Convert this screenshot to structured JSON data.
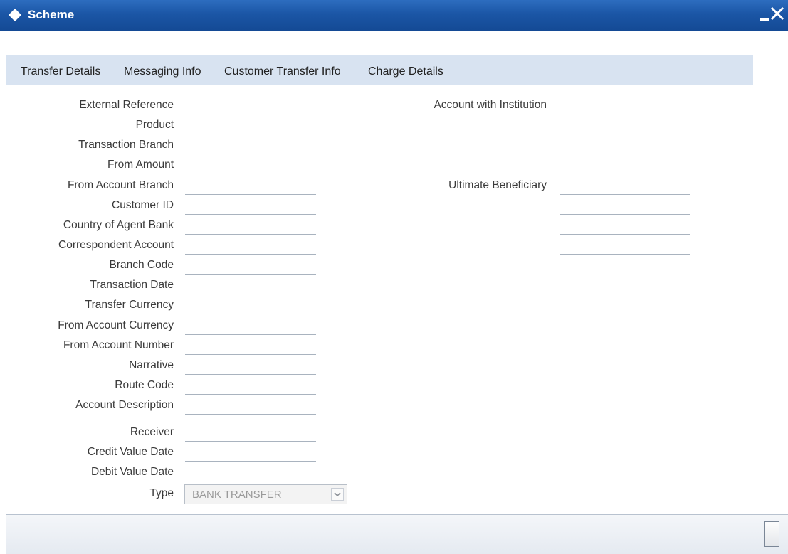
{
  "window": {
    "title": "Scheme",
    "minimize_label": "‗",
    "close_label": "✕"
  },
  "tabs": [
    {
      "label": "Transfer Details"
    },
    {
      "label": "Messaging Info"
    },
    {
      "label": "Customer Transfer Info"
    },
    {
      "label": "Charge Details"
    }
  ],
  "left_fields": [
    {
      "label": "External Reference",
      "value": ""
    },
    {
      "label": "Product",
      "value": ""
    },
    {
      "label": "Transaction Branch",
      "value": ""
    },
    {
      "label": "From Amount",
      "value": ""
    },
    {
      "label": "From Account Branch",
      "value": ""
    },
    {
      "label": "Customer ID",
      "value": ""
    },
    {
      "label": "Country of Agent Bank",
      "value": ""
    },
    {
      "label": "Correspondent Account",
      "value": ""
    },
    {
      "label": "Branch Code",
      "value": ""
    },
    {
      "label": "Transaction Date",
      "value": ""
    },
    {
      "label": "Transfer Currency",
      "value": ""
    },
    {
      "label": "From Account Currency",
      "value": ""
    },
    {
      "label": "From Account Number",
      "value": ""
    },
    {
      "label": "Narrative",
      "value": ""
    },
    {
      "label": "Route Code",
      "value": ""
    },
    {
      "label": "Account Description",
      "value": ""
    },
    {
      "label": "Receiver",
      "value": ""
    },
    {
      "label": "Credit Value Date",
      "value": ""
    },
    {
      "label": "Debit Value Date",
      "value": ""
    }
  ],
  "right_fields": {
    "account_with_institution": {
      "label": "Account with Institution",
      "lines": [
        "",
        "",
        "",
        ""
      ]
    },
    "ultimate_beneficiary": {
      "label": "Ultimate Beneficiary",
      "lines": [
        "",
        "",
        "",
        ""
      ]
    }
  },
  "type_select": {
    "label": "Type",
    "value": "BANK TRANSFER"
  }
}
